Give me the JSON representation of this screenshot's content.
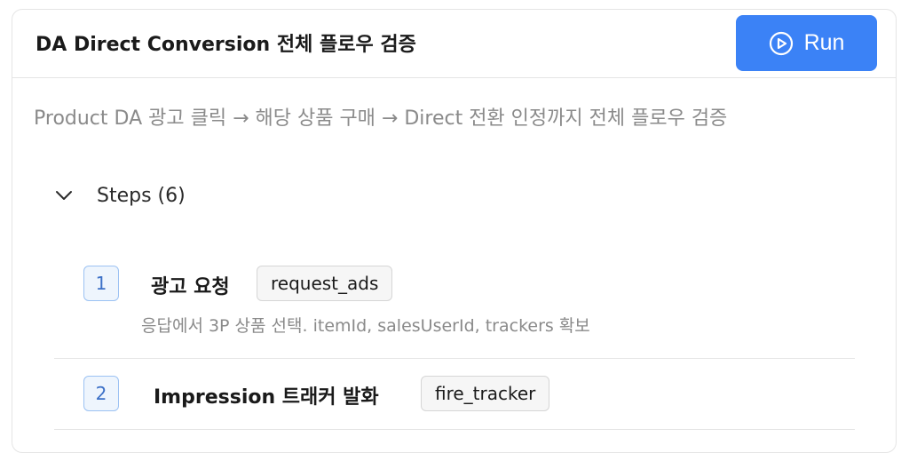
{
  "flow": {
    "title": "DA Direct Conversion 전체 플로우 검증",
    "run_label": "Run",
    "description": "Product DA 광고 클릭 → 해당 상품 구매 → Direct 전환 인정까지 전체 플로우 검증"
  },
  "steps": {
    "header": "Steps (6)",
    "items": [
      {
        "number": "1",
        "title": "광고 요청",
        "code": "request_ads",
        "description": "응답에서 3P 상품 선택. itemId, salesUserId, trackers 확보"
      },
      {
        "number": "2",
        "title": "Impression 트래커 발화",
        "code": "fire_tracker"
      }
    ]
  },
  "colors": {
    "accent": "#3b82f6",
    "step_badge_border": "#9cc2f3",
    "step_badge_bg": "#eef5fd",
    "muted_text": "#8a8a8a"
  },
  "icons": {
    "run": "play-circle-icon",
    "toggle": "chevron-down-icon"
  }
}
